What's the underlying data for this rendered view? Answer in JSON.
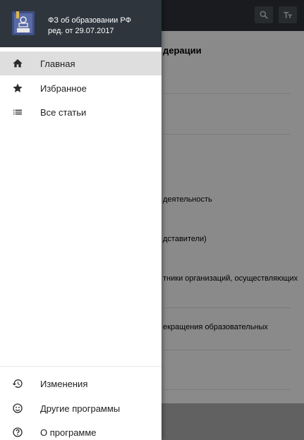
{
  "app": {
    "title_fragment": "дерации",
    "content_lines": [
      "деятельность",
      "дставители)",
      "тники организаций, осуществляющих",
      "екращения образовательных"
    ]
  },
  "toolbar": {
    "search_icon": "search-icon",
    "font_size_icon": "text-size-icon"
  },
  "drawer": {
    "header": {
      "title": "ФЗ об образовании РФ",
      "subtitle": "ред. от 29.07.2017"
    },
    "top_items": [
      {
        "label": "Главная",
        "icon": "home-icon",
        "active": true
      },
      {
        "label": "Избранное",
        "icon": "star-icon",
        "active": false
      },
      {
        "label": "Все статьи",
        "icon": "list-icon",
        "active": false
      }
    ],
    "bottom_items": [
      {
        "label": "Изменения",
        "icon": "history-icon"
      },
      {
        "label": "Другие программы",
        "icon": "smiley-icon"
      },
      {
        "label": "О программе",
        "icon": "help-icon"
      }
    ]
  },
  "colors": {
    "header_bg": "#2e353d",
    "active_item_bg": "#dedede",
    "appbar_bg": "#2f3338"
  }
}
